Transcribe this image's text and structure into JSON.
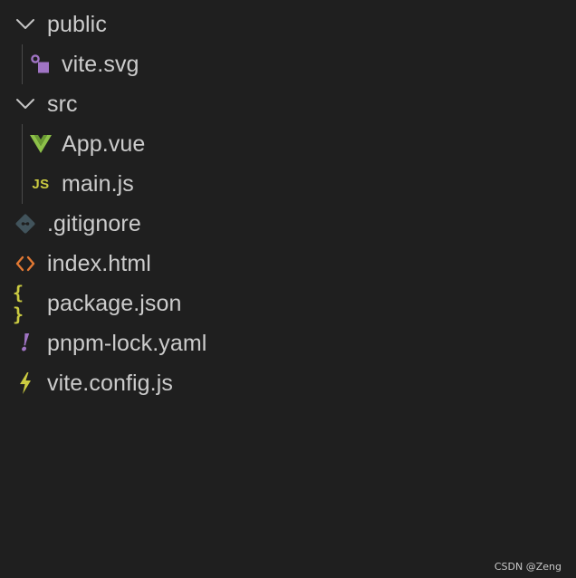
{
  "explorer": {
    "items": [
      {
        "label": "public",
        "kind": "folder",
        "expanded": true,
        "icon": "chevron-down-icon"
      },
      {
        "label": "vite.svg",
        "kind": "file",
        "icon": "svg-file-icon",
        "icon_color": "#a074c4"
      },
      {
        "label": "src",
        "kind": "folder",
        "expanded": true,
        "icon": "chevron-down-icon"
      },
      {
        "label": "App.vue",
        "kind": "file",
        "icon": "vue-file-icon",
        "icon_color": "#8dc149"
      },
      {
        "label": "main.js",
        "kind": "file",
        "icon": "js-file-icon",
        "icon_text": "JS",
        "icon_color": "#cbcb41"
      },
      {
        "label": ".gitignore",
        "kind": "file",
        "icon": "git-file-icon",
        "icon_color": "#41535b"
      },
      {
        "label": "index.html",
        "kind": "file",
        "icon": "html-file-icon",
        "icon_color": "#e37933"
      },
      {
        "label": "package.json",
        "kind": "file",
        "icon": "json-file-icon",
        "icon_text": "{ }",
        "icon_color": "#cbcb41"
      },
      {
        "label": "pnpm-lock.yaml",
        "kind": "file",
        "icon": "yaml-file-icon",
        "icon_text": "!",
        "icon_color": "#a074c4"
      },
      {
        "label": "vite.config.js",
        "kind": "file",
        "icon": "vite-config-icon",
        "icon_color": "#cbcb41"
      }
    ]
  },
  "watermark": "CSDN @Zeng",
  "colors": {
    "background": "#1f1f1f",
    "text": "#cccccc",
    "guide": "#4a4a4a"
  }
}
